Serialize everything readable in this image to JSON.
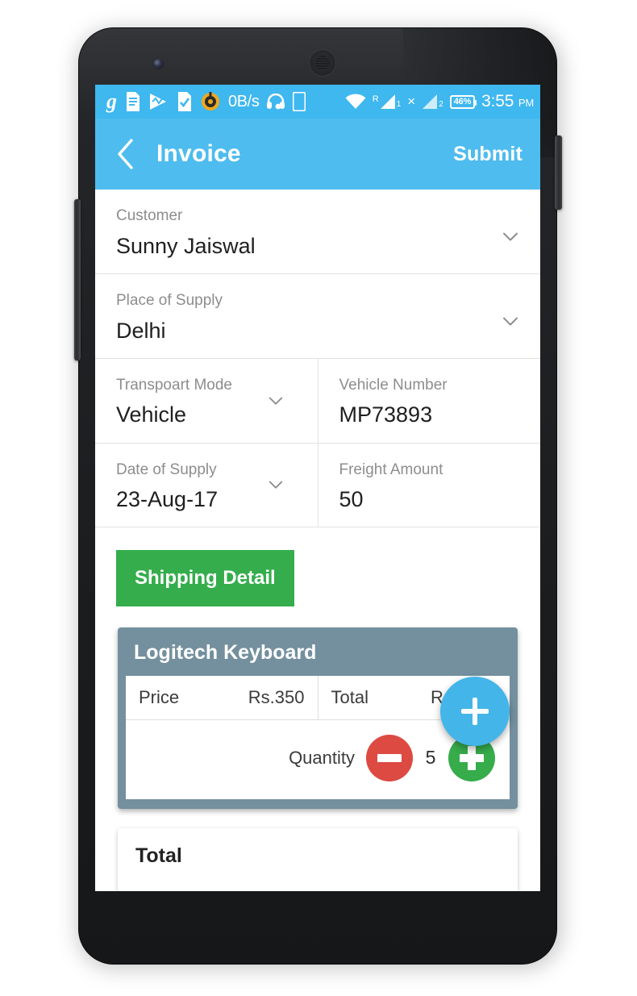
{
  "device": {
    "front_camera": "front-camera",
    "earpiece": "earpiece-speaker",
    "power_button": "power-button",
    "volume_button": "volume-button"
  },
  "status_bar": {
    "left_icons": [
      "g-app-icon",
      "note-icon",
      "play-wave-icon",
      "check-document-icon",
      "orange-target-icon"
    ],
    "network_speed": "0B/s",
    "headset_icon": "headset-icon",
    "sim_card_icon": "sim-card-icon",
    "wifi_icon": "wifi-icon",
    "sim1_roaming_label": "R",
    "sim1_index": "1",
    "sim1_no_service": "×",
    "sim2_index": "2",
    "battery_text": "46%",
    "time": "3:55",
    "time_period": "PM",
    "background_color": "#3fb7ef"
  },
  "app_bar": {
    "back_icon": "chevron-left-icon",
    "title": "Invoice",
    "submit_label": "Submit",
    "background_color": "#4ebcee"
  },
  "form": {
    "rows": [
      {
        "cells": [
          {
            "label": "Customer",
            "value": "Sunny Jaiswal",
            "has_chevron": true
          }
        ]
      },
      {
        "cells": [
          {
            "label": "Place of Supply",
            "value": "Delhi",
            "has_chevron": true
          }
        ]
      },
      {
        "cells": [
          {
            "label": "Transpoart Mode",
            "value": "Vehicle",
            "has_chevron": true
          },
          {
            "label": "Vehicle Number",
            "value": "MP73893",
            "has_chevron": false
          }
        ]
      },
      {
        "cells": [
          {
            "label": "Date of Supply",
            "value": "23-Aug-17",
            "has_chevron": true
          },
          {
            "label": "Freight Amount",
            "value": "50",
            "has_chevron": false
          }
        ]
      }
    ]
  },
  "shipping_button": {
    "label": "Shipping Detail",
    "color": "#35ad4c"
  },
  "product_card": {
    "title": "Logitech Keyboard",
    "header_color": "#74909e",
    "price_label": "Price",
    "price_value": "Rs.350",
    "total_label": "Total",
    "total_value": "Rs.1750",
    "quantity_label": "Quantity",
    "quantity_value": "5",
    "decrement_icon": "minus-circle-icon",
    "increment_icon": "plus-circle-icon",
    "decrement_color": "#dc4a42",
    "increment_color": "#36ac4b"
  },
  "total_card": {
    "title": "Total"
  },
  "fab": {
    "icon": "plus-icon",
    "color": "#44b5e9"
  }
}
